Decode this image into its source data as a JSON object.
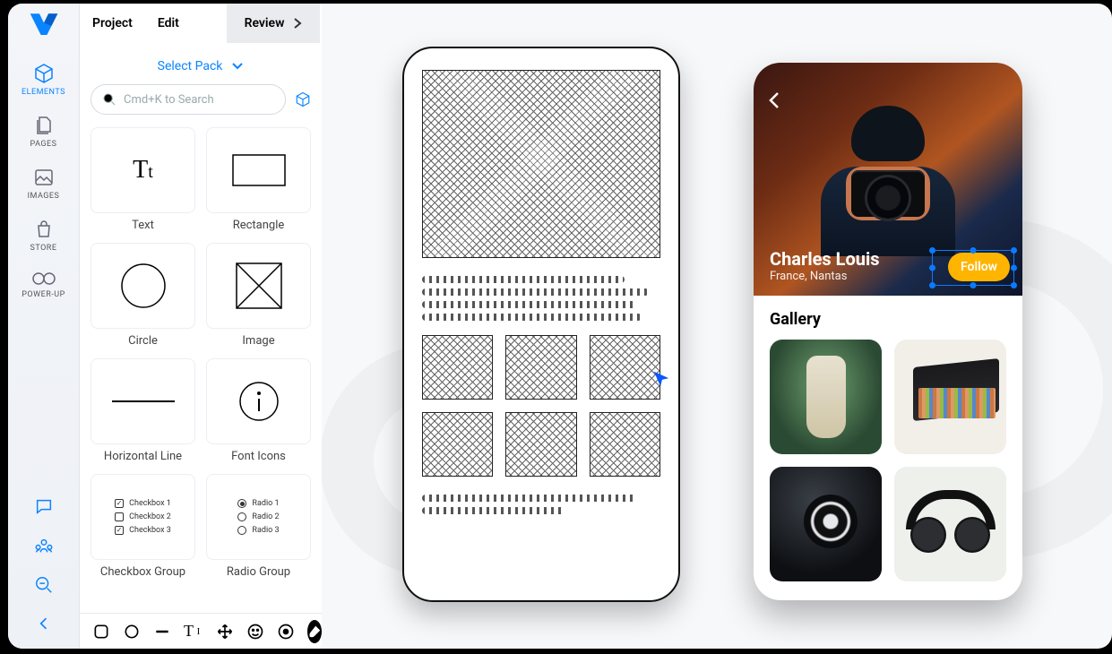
{
  "menu": {
    "project": "Project",
    "edit": "Edit",
    "review": "Review"
  },
  "rail": {
    "elements": "ELEMENTS",
    "pages": "PAGES",
    "images": "IMAGES",
    "store": "STORE",
    "powerup": "POWER-UP"
  },
  "panel": {
    "select_pack": "Select Pack",
    "search_placeholder": "Cmd+K to Search",
    "tiles": {
      "text": "Text",
      "rectangle": "Rectangle",
      "circle": "Circle",
      "image": "Image",
      "hline": "Horizontal Line",
      "fonticons": "Font Icons",
      "checkbox_group": "Checkbox Group",
      "radio_group": "Radio Group"
    },
    "checkbox_items": [
      "Checkbox 1",
      "Checkbox 2",
      "Checkbox 3"
    ],
    "radio_items": [
      "Radio 1",
      "Radio 2",
      "Radio 3"
    ]
  },
  "profile": {
    "name": "Charles Louis",
    "location": "France, Nantas",
    "follow": "Follow",
    "gallery_title": "Gallery"
  }
}
